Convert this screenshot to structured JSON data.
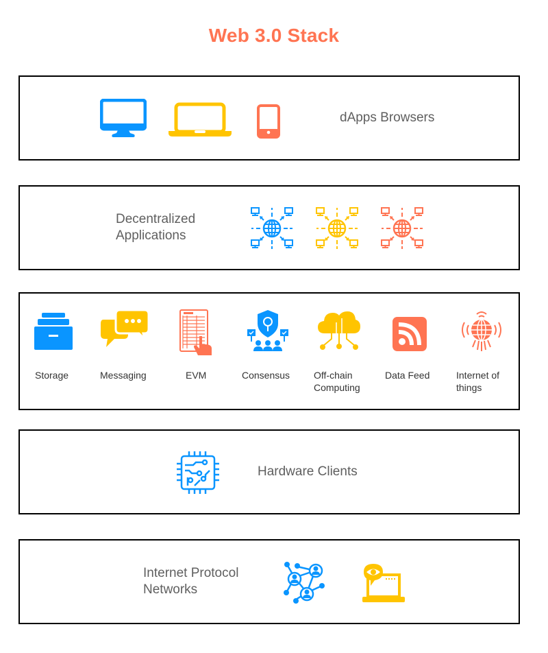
{
  "title": "Web 3.0 Stack",
  "colors": {
    "blue": "#0a95ff",
    "yellow": "#ffc400",
    "orange": "#ff7452",
    "text": "#5f5f5f",
    "border": "#000000"
  },
  "layers": [
    {
      "label": "dApps Browsers",
      "icons": [
        {
          "name": "desktop-monitor-icon",
          "color": "blue"
        },
        {
          "name": "laptop-icon",
          "color": "yellow"
        },
        {
          "name": "mobile-phone-icon",
          "color": "orange"
        }
      ]
    },
    {
      "label_line1": "Decentralized",
      "label_line2": "Applications",
      "icons": [
        {
          "name": "decentralized-network-globe-icon",
          "color": "blue"
        },
        {
          "name": "decentralized-network-globe-icon",
          "color": "yellow"
        },
        {
          "name": "decentralized-network-globe-icon",
          "color": "orange"
        }
      ]
    },
    {
      "items": [
        {
          "label": "Storage",
          "icon": "storage-drawer-icon",
          "color": "blue"
        },
        {
          "label": "Messaging",
          "icon": "chat-bubbles-icon",
          "color": "yellow"
        },
        {
          "label": "EVM",
          "icon": "ballot-machine-icon",
          "color": "orange"
        },
        {
          "label": "Consensus",
          "icon": "consensus-shield-people-icon",
          "color": "blue"
        },
        {
          "label_line1": "Off-chain",
          "label_line2": "Computing",
          "icon": "cloud-computing-icon",
          "color": "yellow"
        },
        {
          "label": "Data Feed",
          "icon": "rss-feed-icon",
          "color": "orange"
        },
        {
          "label_line1": "Internet of",
          "label_line2": "things",
          "icon": "iot-globe-icon",
          "color": "orange"
        }
      ]
    },
    {
      "label": "Hardware Clients",
      "icons": [
        {
          "name": "cpu-chip-icon",
          "color": "blue"
        }
      ]
    },
    {
      "label_line1": "Internet Protocol",
      "label_line2": "Networks",
      "icons": [
        {
          "name": "people-network-icon",
          "color": "blue"
        },
        {
          "name": "laptop-eye-monitoring-icon",
          "color": "yellow"
        }
      ]
    }
  ]
}
